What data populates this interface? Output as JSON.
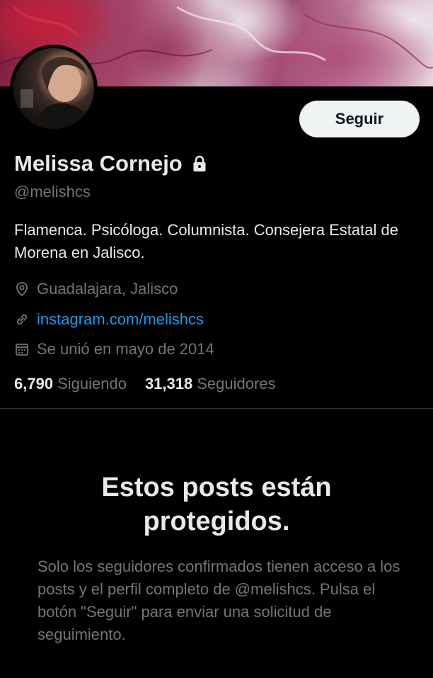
{
  "profile": {
    "follow_label": "Seguir",
    "name": "Melissa Cornejo",
    "handle": "@melishcs",
    "bio": "Flamenca. Psicóloga. Columnista. Consejera Estatal de Morena en Jalisco.",
    "location": "Guadalajara, Jalisco",
    "website": "instagram.com/melishcs",
    "joined": "Se unió en mayo de 2014",
    "following_count": "6,790",
    "following_label": "Siguiendo",
    "followers_count": "31,318",
    "followers_label": "Seguidores"
  },
  "protected": {
    "title": "Estos posts están protegidos.",
    "description": "Solo los seguidores confirmados tienen acceso a los posts y el perfil completo de @melishcs. Pulsa el botón \"Seguir\" para enviar una solicitud de seguimiento."
  },
  "icons": {
    "lock": "lock-icon",
    "location": "location-pin-icon",
    "website": "link-icon",
    "joined": "calendar-icon"
  },
  "colors": {
    "background": "#000000",
    "text_primary": "#e7e9ea",
    "text_secondary": "#71767b",
    "link": "#1d9bf0",
    "button_bg": "#eff3f4",
    "button_text": "#0f1419"
  }
}
